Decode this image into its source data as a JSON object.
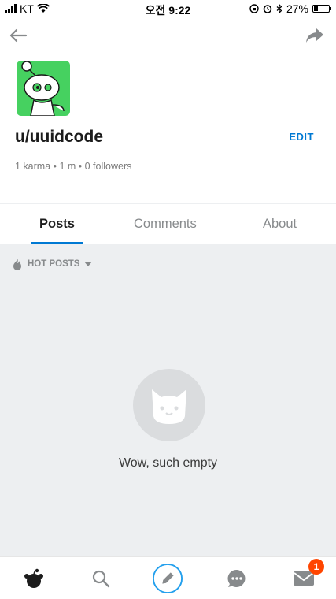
{
  "status_bar": {
    "carrier": "KT",
    "time": "오전 9:22",
    "battery": "27%"
  },
  "profile": {
    "username": "u/uuidcode",
    "edit_label": "EDIT",
    "stats": "1 karma • 1 m • 0 followers"
  },
  "tabs": [
    {
      "label": "Posts",
      "active": true
    },
    {
      "label": "Comments",
      "active": false
    },
    {
      "label": "About",
      "active": false
    }
  ],
  "sort": {
    "label": "HOT POSTS"
  },
  "empty_state": {
    "message": "Wow, such empty"
  },
  "bottom_nav": {
    "items": [
      "home-icon",
      "search-icon",
      "create-post-icon",
      "chat-icon",
      "inbox-icon"
    ],
    "inbox_badge": "1"
  },
  "colors": {
    "accent": "#0079d3",
    "avatar_bg": "#46d160",
    "badge": "#ff4500",
    "content_bg": "#edeff1"
  }
}
